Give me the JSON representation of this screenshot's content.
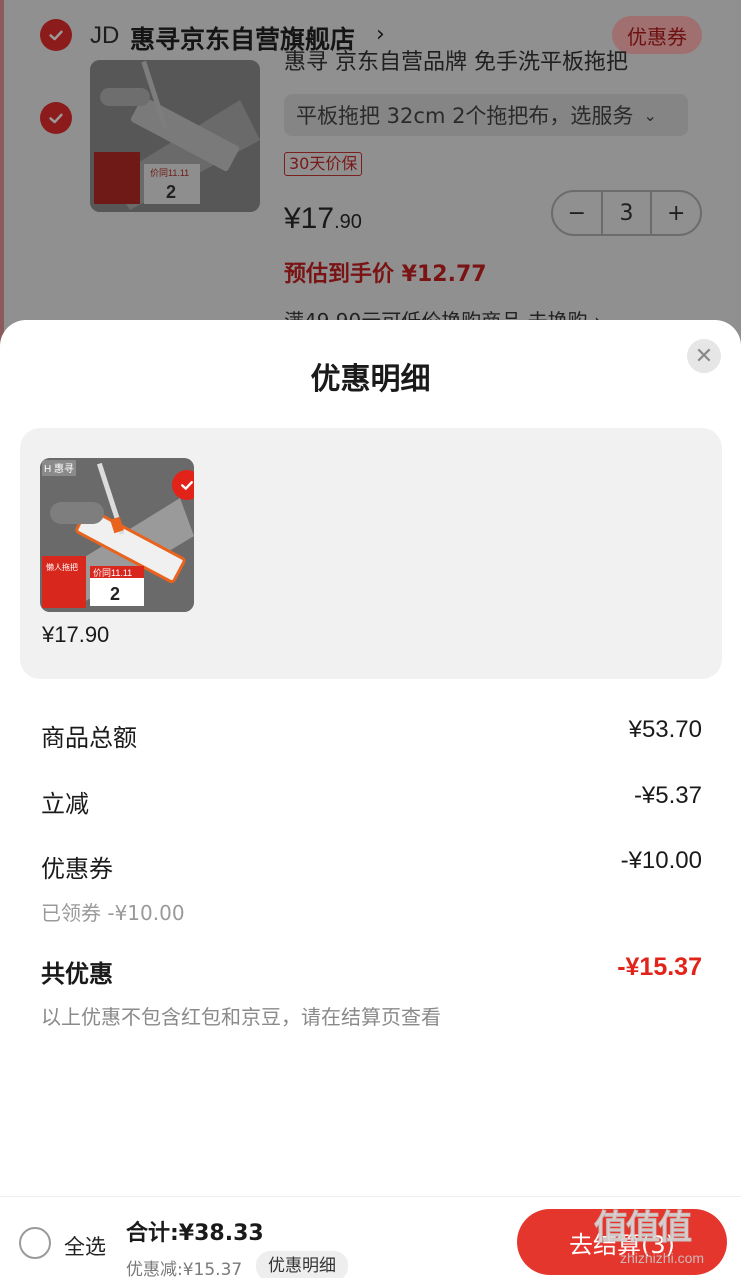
{
  "cart": {
    "shop_logo": "JD",
    "shop_name": "惠寻京东自营旗舰店",
    "shop_chevron": "›",
    "coupon_label": "优惠券",
    "product_title": "惠寻 京东自营品牌 免手洗平板拖把",
    "spec": "平板拖把 32cm 2个拖把布，选服务",
    "spec_chevron": "⌄",
    "price_protect_tag": "30天价保",
    "price_main": "¥17",
    "price_decimal": ".90",
    "estimate_label": "预估到手价 ¥12.77",
    "quantity": "3",
    "minus": "−",
    "plus": "+",
    "promo_line": "满49.90元可低价换购商品                    去换购 ›"
  },
  "sheet": {
    "title": "优惠明细",
    "close": "✕",
    "item_price": "¥17.90",
    "rows": [
      {
        "label": "商品总额",
        "value": "¥53.70"
      },
      {
        "label": "立减",
        "value": "-¥5.37"
      },
      {
        "label": "优惠券",
        "value": "-¥10.00"
      }
    ],
    "coupon_sub": "已领券 -¥10.00",
    "total_label": "共优惠",
    "total_value": "-¥15.37",
    "note": "以上优惠不包含红包和京豆，请在结算页查看"
  },
  "footer": {
    "select_all": "全选",
    "sum": "合计:¥38.33",
    "discount": "优惠减:¥15.37",
    "detail": "优惠明细",
    "checkout": "去结算(3)"
  },
  "watermark": {
    "text": "值值值",
    "url": "zhizhizhi.com"
  },
  "colors": {
    "accent_red": "#e2231a",
    "checkout_red": "#e5362d"
  }
}
